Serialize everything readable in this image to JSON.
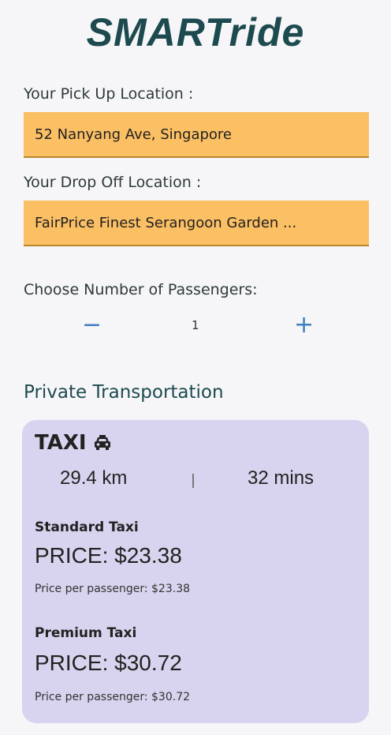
{
  "app": {
    "title": "SMARTride"
  },
  "pickup": {
    "label": "Your Pick Up Location :",
    "value": "52 Nanyang Ave, Singapore"
  },
  "dropoff": {
    "label": "Your Drop Off Location :",
    "value": "FairPrice Finest Serangoon Garden ..."
  },
  "passengers": {
    "label": "Choose Number of Passengers:",
    "minus": "−",
    "count": "1",
    "plus": "+"
  },
  "section": {
    "title": "Private Transportation"
  },
  "taxi": {
    "title": "TAXI",
    "icon": "taxi-icon",
    "distance": "29.4 km",
    "duration": "32 mins",
    "standard": {
      "name": "Standard Taxi",
      "price": "PRICE:  $23.38",
      "per_passenger": "Price per passenger:  $23.38"
    },
    "premium": {
      "name": "Premium Taxi",
      "price": "PRICE:  $30.72",
      "per_passenger": "Price per passenger:  $30.72"
    }
  },
  "colors": {
    "accent_field": "#fbbf64",
    "card_bg": "#d8d3ee",
    "brand": "#1d4a4f",
    "stepper": "#3f7fbf"
  }
}
